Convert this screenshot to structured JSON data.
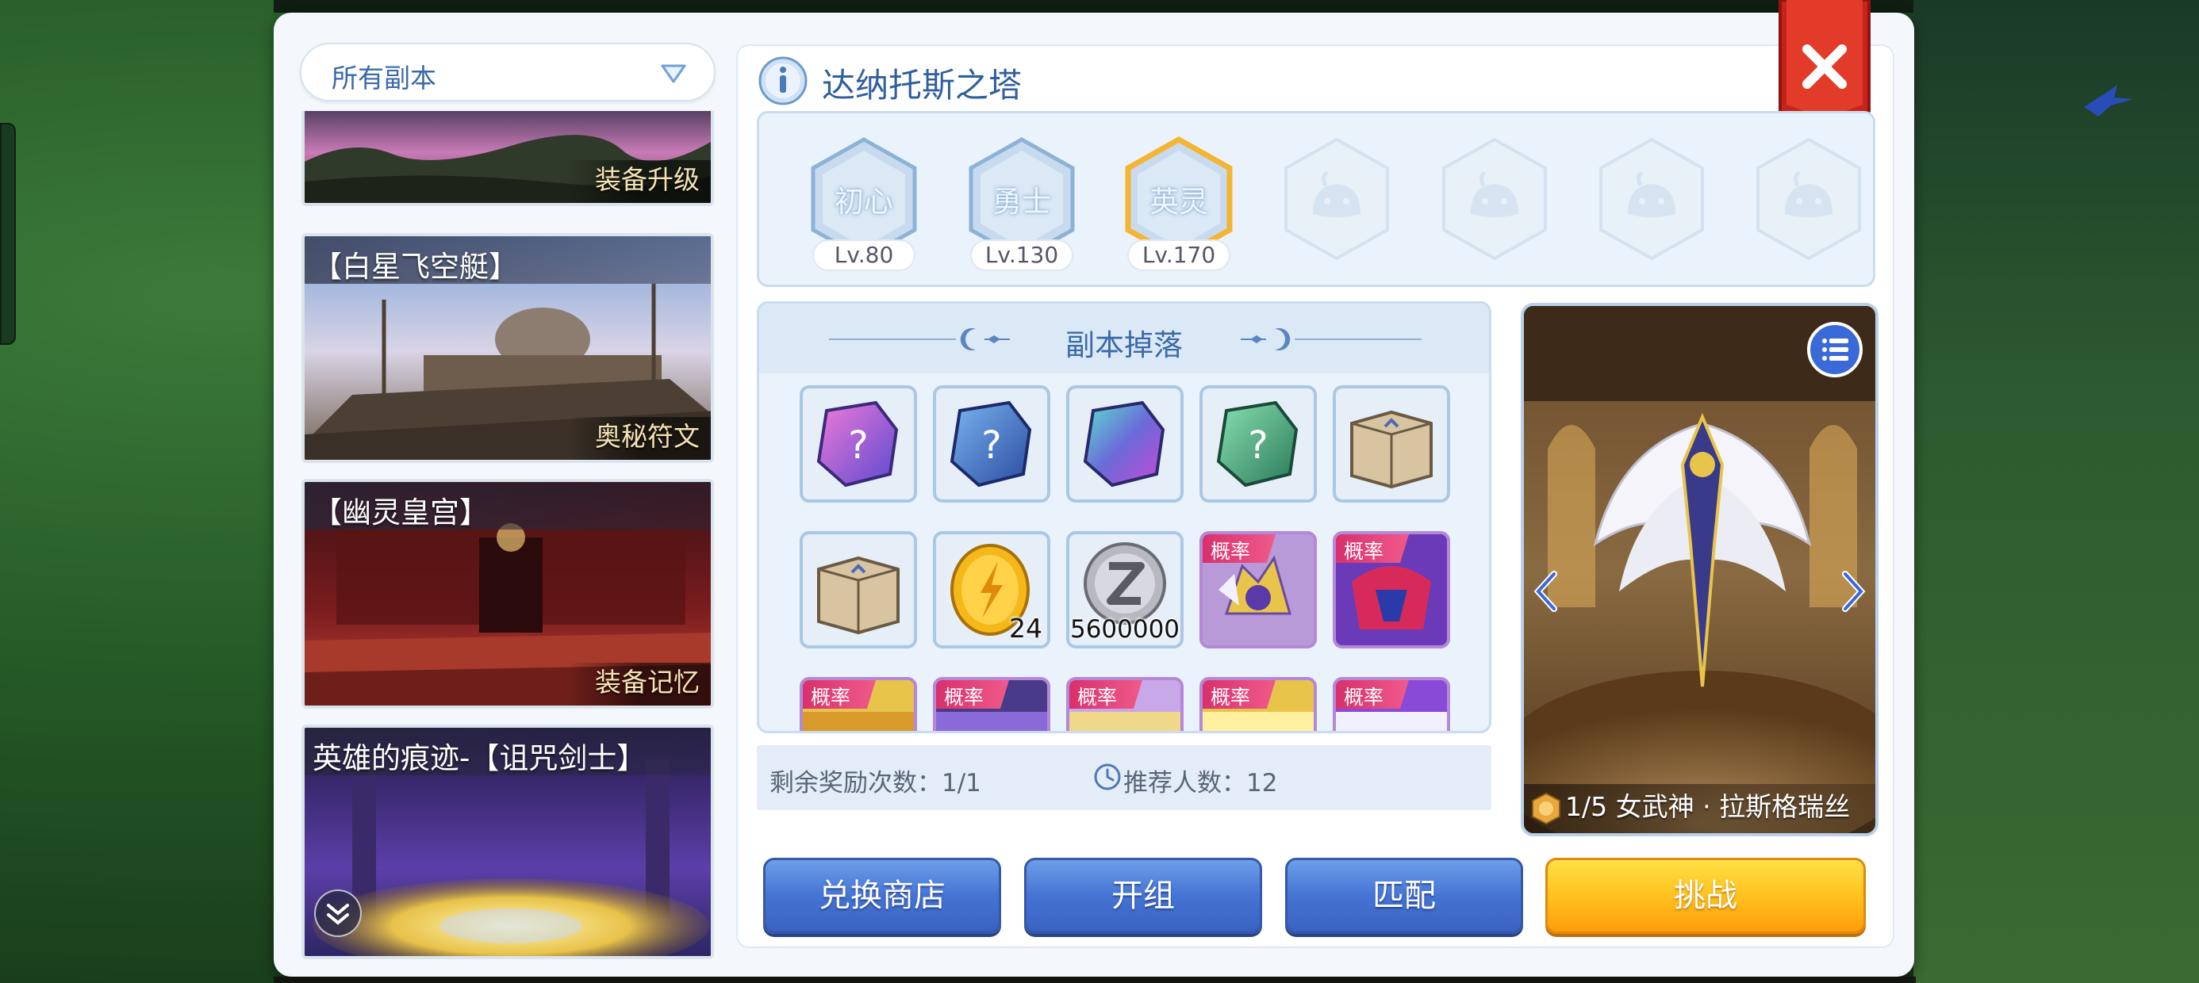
{
  "dropdown": {
    "label": "所有副本"
  },
  "dungeon_list": [
    {
      "title": "",
      "tag": "装备升级"
    },
    {
      "title": "【白星飞空艇】",
      "tag": "奥秘符文"
    },
    {
      "title": "【幽灵皇宫】",
      "tag": "装备记忆"
    },
    {
      "title": "英雄的痕迹-【诅咒剑士】",
      "tag": ""
    }
  ],
  "header": {
    "title": "达纳托斯之塔"
  },
  "difficulties": [
    {
      "label": "初心",
      "level": "Lv.80",
      "state": "unlocked"
    },
    {
      "label": "勇士",
      "level": "Lv.130",
      "state": "unlocked"
    },
    {
      "label": "英灵",
      "level": "Lv.170",
      "state": "selected"
    },
    {
      "label": "",
      "level": "",
      "state": "locked"
    },
    {
      "label": "",
      "level": "",
      "state": "locked"
    },
    {
      "label": "",
      "level": "",
      "state": "locked"
    },
    {
      "label": "",
      "level": "",
      "state": "locked"
    }
  ],
  "drops": {
    "title": "副本掉落",
    "probability_label": "概率",
    "items": [
      {
        "icon": "purple-mystery-gem-icon",
        "count": ""
      },
      {
        "icon": "blue-mystery-gem-icon",
        "count": ""
      },
      {
        "icon": "rainbow-gem-icon",
        "count": ""
      },
      {
        "icon": "green-mystery-gem-icon",
        "count": ""
      },
      {
        "icon": "supply-box-icon",
        "count": ""
      },
      {
        "icon": "supply-box-icon",
        "count": ""
      },
      {
        "icon": "gold-medal-icon",
        "count": "24"
      },
      {
        "icon": "zeny-coin-icon",
        "count": "5600000"
      }
    ]
  },
  "stats": {
    "remaining_rewards": "剩余奖励次数：1/1",
    "recommended_players": "推荐人数：12"
  },
  "preview": {
    "caption": "1/5 女武神 · 拉斯格瑞丝"
  },
  "buttons": {
    "exchange_shop": "兑换商店",
    "form_group": "开组",
    "match": "匹配",
    "challenge": "挑战"
  },
  "colors": {
    "title_blue": "#2f5f9c",
    "button_blue": "#4574d4",
    "button_gold": "#ffc21e",
    "close_red": "#d8291e",
    "selected_hex_gold": "#f5b432",
    "probability_pink": "#e0407a"
  }
}
